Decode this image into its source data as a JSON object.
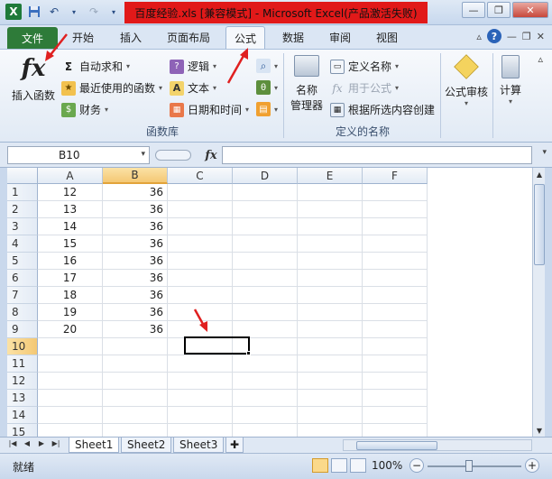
{
  "window": {
    "title": "百度经验.xls  [兼容模式]  -  Microsoft Excel(产品激活失败)",
    "app_icon_text": "X",
    "title_highlight_color": "#e11919"
  },
  "qat": {
    "save_icon": "save-icon",
    "undo_icon": "undo-icon",
    "redo_icon": "redo-icon"
  },
  "tabs": {
    "file": "文件",
    "home": "开始",
    "insert": "插入",
    "page_layout": "页面布局",
    "formulas": "公式",
    "data": "数据",
    "review": "审阅",
    "view": "视图",
    "active": "公式"
  },
  "ribbon": {
    "insert_function": "插入函数",
    "autosum": "自动求和",
    "recent": "最近使用的函数",
    "financial": "财务",
    "logical": "逻辑",
    "text": "文本",
    "datetime": "日期和时间",
    "group_function_library": "函数库",
    "name_manager_line1": "名称",
    "name_manager_line2": "管理器",
    "define_name": "定义名称",
    "use_in_formula": "用于公式",
    "create_from_selection": "根据所选内容创建",
    "group_defined_names": "定义的名称",
    "formula_auditing": "公式审核",
    "calculation": "计算"
  },
  "formula_bar": {
    "name_box": "B10",
    "fx_label": "fx",
    "formula": ""
  },
  "grid": {
    "columns": [
      "A",
      "B",
      "C",
      "D",
      "E",
      "F"
    ],
    "selected_column": "B",
    "rows": [
      {
        "num": "1",
        "a": "12",
        "b": "36"
      },
      {
        "num": "2",
        "a": "13",
        "b": "36"
      },
      {
        "num": "3",
        "a": "14",
        "b": "36"
      },
      {
        "num": "4",
        "a": "15",
        "b": "36"
      },
      {
        "num": "5",
        "a": "16",
        "b": "36"
      },
      {
        "num": "6",
        "a": "17",
        "b": "36"
      },
      {
        "num": "7",
        "a": "18",
        "b": "36"
      },
      {
        "num": "8",
        "a": "19",
        "b": "36"
      },
      {
        "num": "9",
        "a": "20",
        "b": "36"
      },
      {
        "num": "10",
        "a": "",
        "b": ""
      },
      {
        "num": "11",
        "a": "",
        "b": ""
      },
      {
        "num": "12",
        "a": "",
        "b": ""
      },
      {
        "num": "13",
        "a": "",
        "b": ""
      },
      {
        "num": "14",
        "a": "",
        "b": ""
      },
      {
        "num": "15",
        "a": "",
        "b": ""
      }
    ],
    "selected_row": "10"
  },
  "sheets": {
    "tabs": [
      "Sheet1",
      "Sheet2",
      "Sheet3"
    ],
    "active": "Sheet1"
  },
  "status": {
    "ready": "就绪",
    "zoom": "100%",
    "zoom_minus": "−",
    "zoom_plus": "+"
  },
  "colors": {
    "file_tab": "#2e7b39",
    "annotation": "#e02020"
  }
}
